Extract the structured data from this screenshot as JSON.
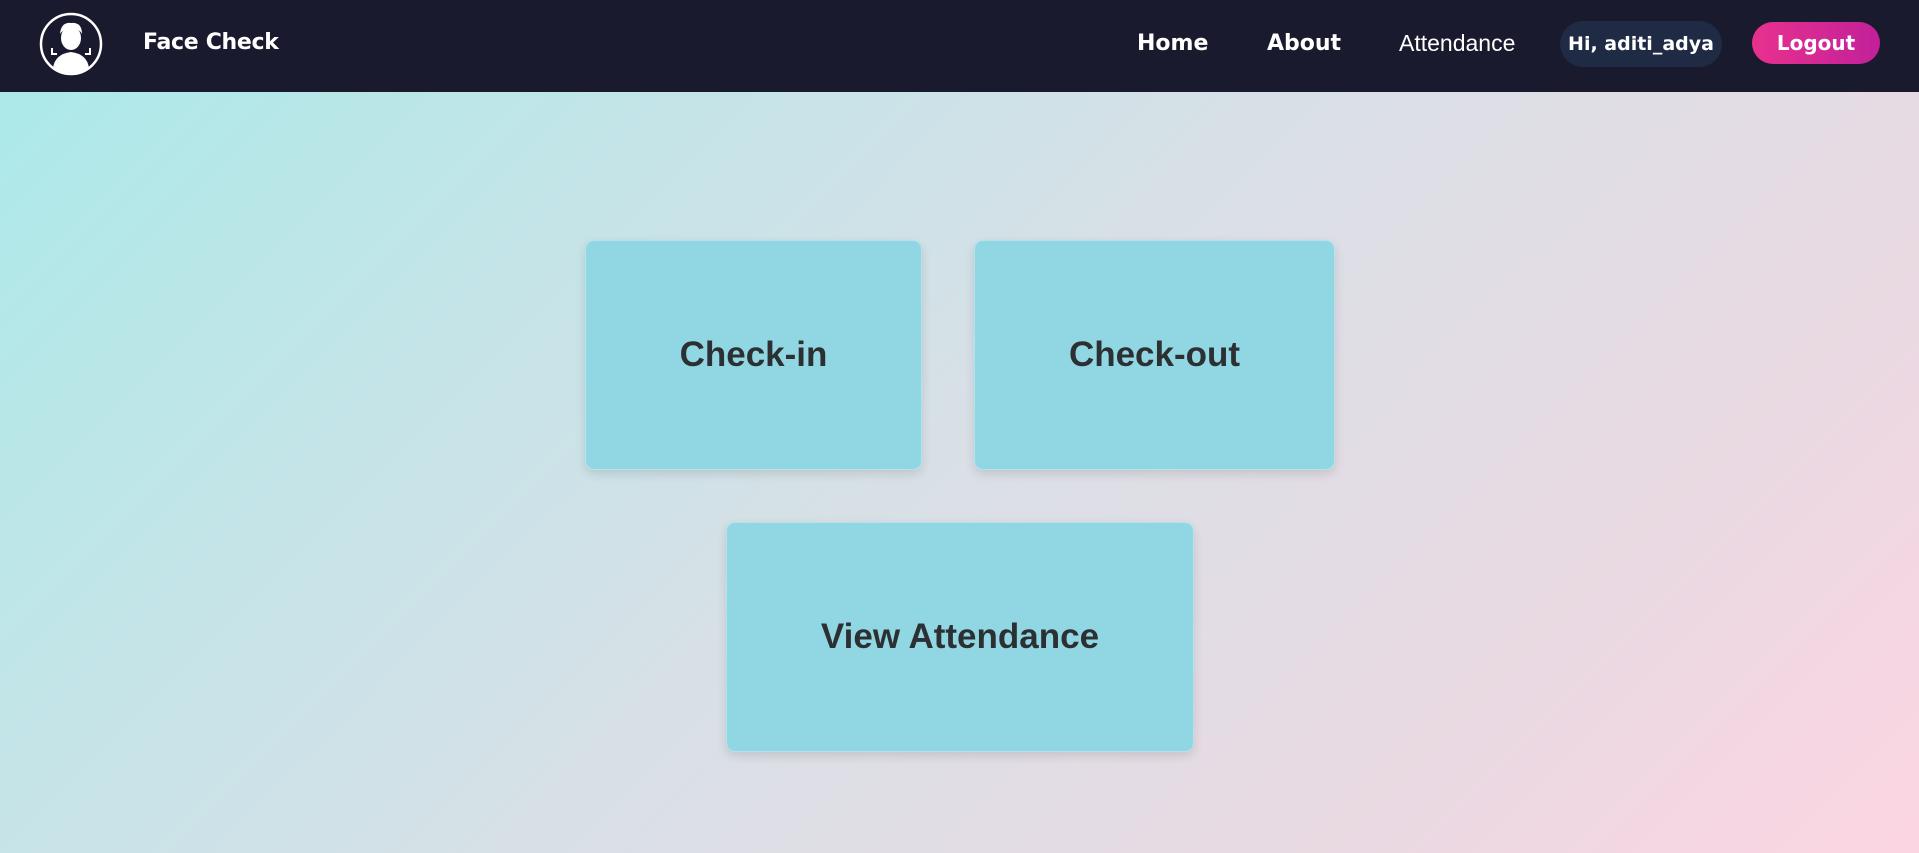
{
  "app": {
    "brand": "Face Check",
    "logo_icon": "face-scan-icon"
  },
  "nav": {
    "home": "Home",
    "about": "About",
    "attendance": "Attendance",
    "greeting": "Hi, aditi_adya",
    "logout": "Logout"
  },
  "cards": {
    "checkin": "Check-in",
    "checkout": "Check-out",
    "view_attendance": "View Attendance"
  },
  "colors": {
    "navbar": "#1a1a2e",
    "logout_accent": "#e8318e",
    "card": "#91d7e3",
    "card_text": "#2d3033"
  }
}
